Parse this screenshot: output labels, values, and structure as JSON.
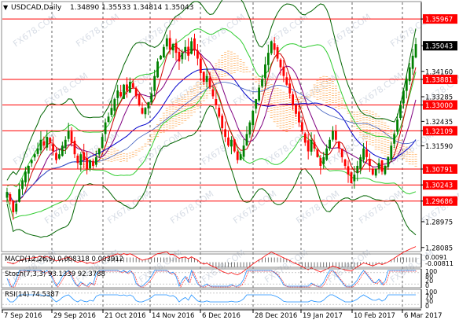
{
  "header": {
    "symbol": "USDCAD,Daily",
    "ohlc": "1.34890 1.35533 1.34814 1.35043"
  },
  "watermark": "FX678.COM",
  "colors": {
    "background": "#ffffff",
    "bull_candle": "#008000",
    "bear_candle": "#ff0000",
    "ma1": "#cc0000",
    "ma2": "#0000cc",
    "ma3": "#800080",
    "bb_outer": "#006400",
    "bb_inner": "#32cd32",
    "cloud": "#ffa040",
    "hline": "#ff0000",
    "price_box": "#000000"
  },
  "chart_data": {
    "type": "candlestick",
    "title": "USDCAD,Daily",
    "x_labels": [
      "7 Sep 2016",
      "29 Sep 2016",
      "21 Oct 2016",
      "14 Nov 2016",
      "6 Dec 2016",
      "28 Dec 2016",
      "19 Jan 2017",
      "10 Feb 2017",
      "6 Mar 2017"
    ],
    "y_ticks": [
      1.28085,
      1.28975,
      1.29686,
      1.30243,
      1.30791,
      1.3159,
      1.32109,
      1.32435,
      1.33,
      1.33285,
      1.33881,
      1.3416,
      1.35043,
      1.35967
    ],
    "ylim": [
      1.2797,
      1.3654
    ],
    "horizontal_levels": [
      1.35967,
      1.33881,
      1.33,
      1.32109,
      1.30791,
      1.30243,
      1.29686
    ],
    "current_price": 1.35043,
    "candle_closes": [
      1.3,
      1.297,
      1.293,
      1.296,
      1.301,
      1.304,
      1.307,
      1.309,
      1.311,
      1.313,
      1.315,
      1.318,
      1.316,
      1.319,
      1.317,
      1.314,
      1.311,
      1.313,
      1.316,
      1.318,
      1.321,
      1.317,
      1.313,
      1.31,
      1.313,
      1.311,
      1.308,
      1.311,
      1.309,
      1.312,
      1.315,
      1.319,
      1.324,
      1.326,
      1.329,
      1.332,
      1.335,
      1.333,
      1.337,
      1.335,
      1.338,
      1.336,
      1.333,
      1.33,
      1.327,
      1.329,
      1.331,
      1.334,
      1.34,
      1.345,
      1.347,
      1.35,
      1.353,
      1.349,
      1.351,
      1.348,
      1.345,
      1.348,
      1.35,
      1.347,
      1.352,
      1.349,
      1.346,
      1.341,
      1.338,
      1.34,
      1.336,
      1.333,
      1.33,
      1.326,
      1.322,
      1.319,
      1.316,
      1.318,
      1.314,
      1.311,
      1.313,
      1.316,
      1.32,
      1.324,
      1.328,
      1.332,
      1.336,
      1.339,
      1.344,
      1.348,
      1.352,
      1.349,
      1.346,
      1.343,
      1.34,
      1.337,
      1.334,
      1.33,
      1.327,
      1.324,
      1.321,
      1.317,
      1.314,
      1.318,
      1.315,
      1.312,
      1.309,
      1.312,
      1.315,
      1.318,
      1.321,
      1.318,
      1.315,
      1.312,
      1.309,
      1.306,
      1.303,
      1.306,
      1.309,
      1.312,
      1.315,
      1.312,
      1.309,
      1.306,
      1.308,
      1.31,
      1.307,
      1.309,
      1.312,
      1.316,
      1.32,
      1.325,
      1.33,
      1.335,
      1.339,
      1.343,
      1.347,
      1.351
    ],
    "indicators": [
      {
        "label": "MACD(12,26,9) 0.008318 0.003912",
        "scale": [
          "0.0091",
          "-0.00811"
        ]
      },
      {
        "label": "Stoch(7,3,3) 93.1339 92.3788",
        "scale": [
          "100",
          "80",
          "20",
          "0"
        ]
      },
      {
        "label": "RSI(14) 74.5387",
        "scale": [
          "100",
          "70",
          "30",
          "0"
        ]
      }
    ],
    "legend": "none",
    "grid": "vertical dashed"
  }
}
